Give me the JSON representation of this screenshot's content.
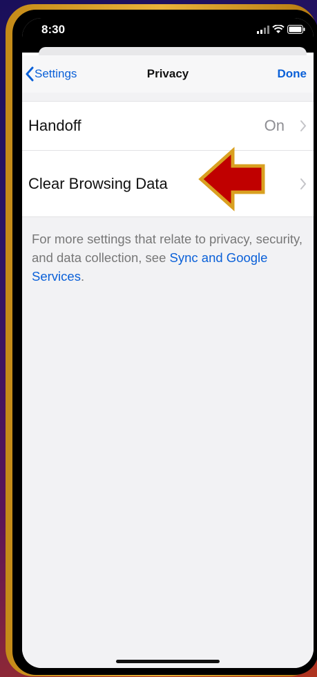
{
  "status_bar": {
    "time": "8:30"
  },
  "nav": {
    "back_label": "Settings",
    "title": "Privacy",
    "done_label": "Done"
  },
  "rows": [
    {
      "label": "Handoff",
      "value": "On"
    },
    {
      "label": "Clear Browsing Data"
    }
  ],
  "footer": {
    "text": "For more settings that relate to privacy, security, and data collection, see ",
    "link": "Sync and Google Services",
    "suffix": "."
  },
  "colors": {
    "accent": "#0a60d8",
    "arrow": "#c00000",
    "frame": "#e0a830"
  },
  "icons": [
    "back-chevron-icon",
    "signal-icon",
    "wifi-icon",
    "battery-icon",
    "chevron-right-icon",
    "arrow-pointer-icon"
  ]
}
